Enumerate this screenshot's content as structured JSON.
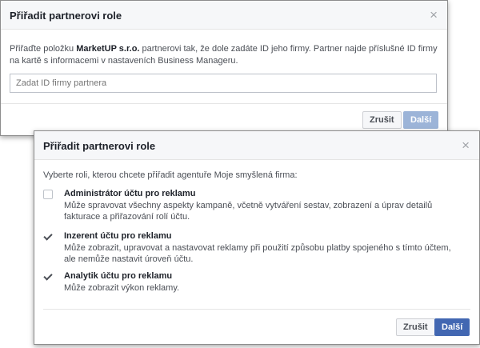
{
  "dialog1": {
    "title": "Přiřadit partnerovi role",
    "close": "×",
    "desc_before": "Přiřaďte položku ",
    "company": "MarketUP s.r.o.",
    "desc_after": " partnerovi tak, že dole zadáte ID jeho firmy. Partner najde příslušné ID firmy na kartě s informacemi v nastaveních Business Manageru.",
    "input_placeholder": "Zadat ID firmy partnera",
    "cancel_label": "Zrušit",
    "next_label": "Další"
  },
  "dialog2": {
    "title": "Přiřadit partnerovi role",
    "close": "×",
    "intro": "Vyberte roli, kterou chcete přiřadit agentuře Moje smyšlená firma:",
    "roles": [
      {
        "name": "Administrátor účtu pro reklamu",
        "desc": "Může spravovat všechny aspekty kampaně, včetně vytváření sestav, zobrazení a úprav detailů fakturace a přiřazování rolí účtu.",
        "checked": false
      },
      {
        "name": "Inzerent účtu pro reklamu",
        "desc": "Může zobrazit, upravovat a nastavovat reklamy při použití způsobu platby spojeného s tímto účtem, ale nemůže nastavit úroveň účtu.",
        "checked": true
      },
      {
        "name": "Analytik účtu pro reklamu",
        "desc": "Může zobrazit výkon reklamy.",
        "checked": true
      }
    ],
    "cancel_label": "Zrušit",
    "next_label": "Další"
  },
  "colors": {
    "primary": "#4267b2",
    "primary_disabled": "#9cb4d8"
  }
}
